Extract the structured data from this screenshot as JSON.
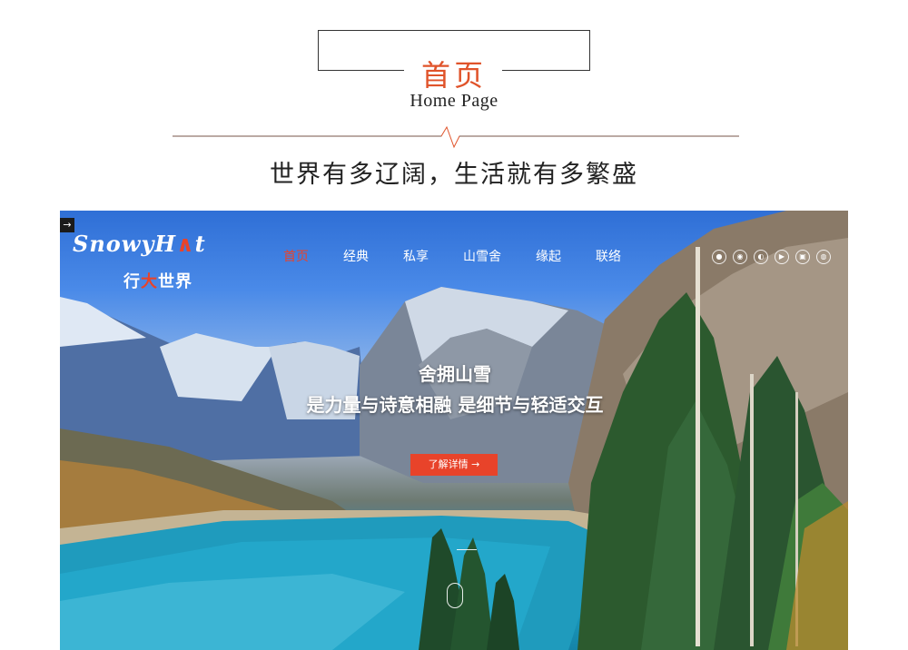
{
  "header": {
    "title_cn": "首页",
    "title_en": "Home Page",
    "slogan": "世界有多辽阔，生活就有多繁盛"
  },
  "site": {
    "logo_en_a": "Snowy",
    "logo_en_b": "H",
    "logo_en_c": "∧",
    "logo_en_d": "t",
    "logo_cn_a": "行",
    "logo_cn_b": "大",
    "logo_cn_c": "世界",
    "corner_icon": "→",
    "nav": [
      {
        "label": "首页"
      },
      {
        "label": "经典"
      },
      {
        "label": "私享"
      },
      {
        "label": "山雪舍"
      },
      {
        "label": "缘起"
      },
      {
        "label": "联络"
      }
    ],
    "socials": [
      "weibo-icon",
      "wechat-icon",
      "qq-icon",
      "video-icon",
      "camera-icon",
      "chat-icon"
    ],
    "hero_title": "舍拥山雪",
    "hero_sub": "是力量与诗意相融 是细节与轻适交互",
    "cta_label": "了解详情 →"
  },
  "colors": {
    "accent": "#e8432a",
    "title_red": "#e0532a",
    "text_dark": "#222222"
  }
}
